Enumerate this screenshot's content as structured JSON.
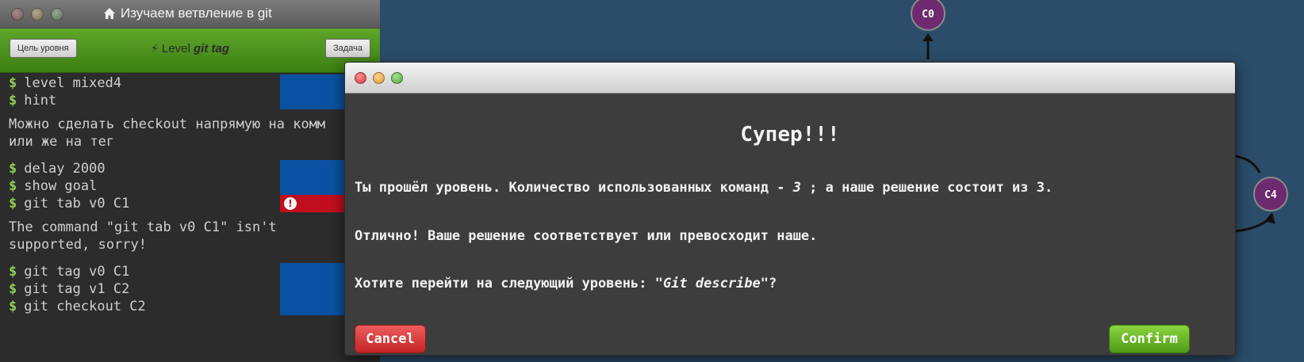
{
  "window": {
    "title": "Изучаем ветвление в git"
  },
  "level_bar": {
    "goal_button": "Цель уровня",
    "level_prefix": "Level",
    "level_name": "git tag",
    "task_button": "Задача"
  },
  "terminal": {
    "prompt": "$",
    "group1": [
      "level mixed4",
      "hint"
    ],
    "output1": "Можно сделать checkout напрямую на комм\nили же на тег",
    "group2": [
      "delay 2000",
      "show goal",
      "git tab v0 C1"
    ],
    "output2": "The command \"git tab v0 C1\" isn't\nsupported, sorry!",
    "group3": [
      "git tag v0 C1",
      "git tag v1 C2",
      "git checkout C2"
    ],
    "error_icon": "!"
  },
  "graph": {
    "nodes": [
      "C0",
      "C4"
    ],
    "node_color": "#6e2a6e",
    "edge_color": "#111111"
  },
  "modal": {
    "heading": "Супер!!!",
    "line1_before": "Ты прошёл уровень. Количество использованных команд - ",
    "line1_count": "3",
    "line1_after": " ; а наше решение состоит из 3.",
    "line2": "Отлично! Ваше решение соответствует или превосходит наше.",
    "line3_before": "Хотите перейти на следующий уровень: ",
    "line3_level": "\"Git describe\"",
    "line3_after": "?",
    "cancel_label": "Cancel",
    "confirm_label": "Confirm"
  },
  "colors": {
    "background": "#2b4d6a",
    "level_bar": "#4f9420",
    "status_ok": "#0a52a1",
    "status_error": "#c10e1e",
    "cancel": "#d13a3a",
    "confirm": "#66b32a"
  }
}
